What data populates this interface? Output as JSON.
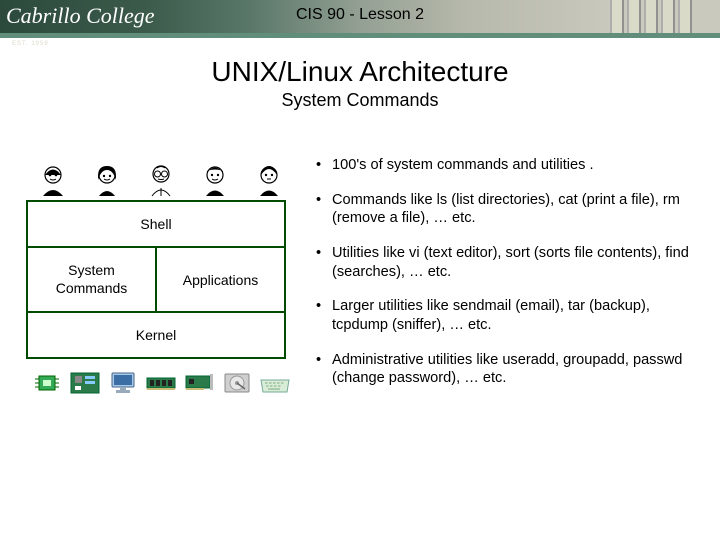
{
  "brand": {
    "college_name": "Cabrillo College",
    "est": "EST. 1959"
  },
  "header": {
    "course_title": "CIS 90 - Lesson 2"
  },
  "slide": {
    "title": "UNIX/Linux Architecture",
    "subtitle": "System Commands"
  },
  "arch": {
    "shell": "Shell",
    "syscmd": "System Commands",
    "apps": "Applications",
    "kernel": "Kernel"
  },
  "bullets": {
    "b1": "100's of system commands and utilities .",
    "b2": "Commands like ls (list directories), cat (print a file), rm (remove a file), … etc.",
    "b3": "Utilities like vi (text editor), sort (sorts file contents), find (searches), … etc.",
    "b4": "Larger utilities like sendmail (email), tar (backup), tcpdump (sniffer), … etc.",
    "b5": "Administrative utilities like useradd, groupadd, passwd (change password), … etc."
  }
}
